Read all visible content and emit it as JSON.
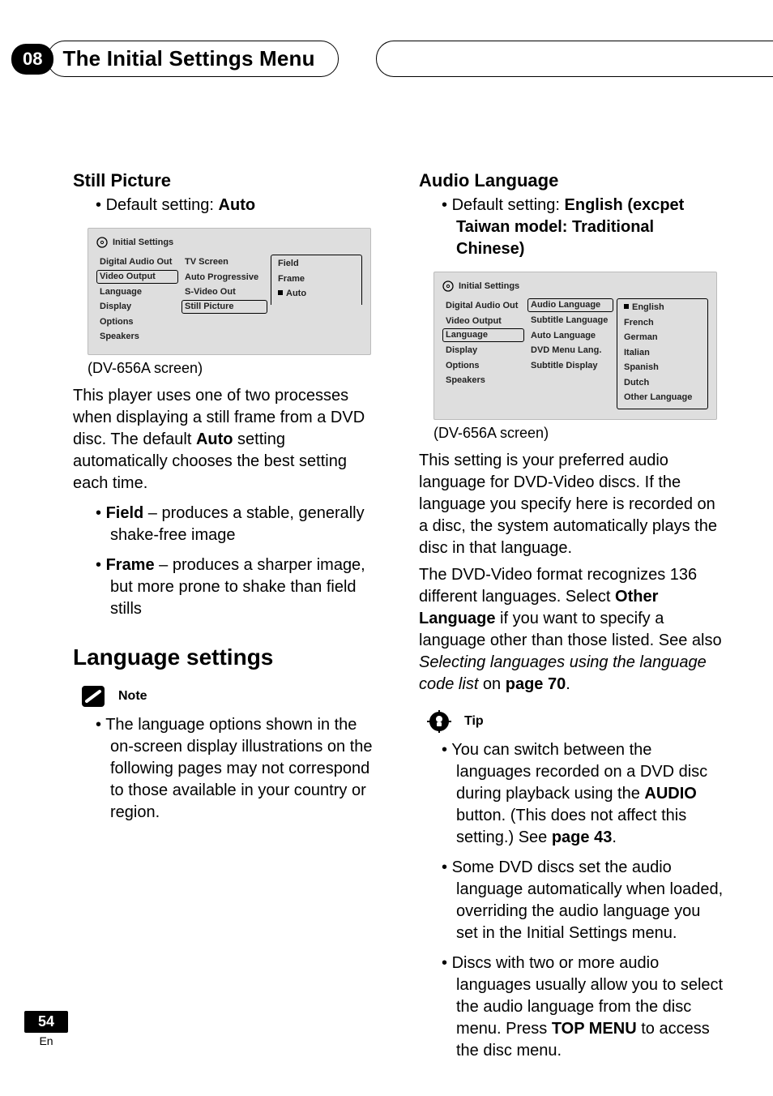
{
  "header": {
    "chapter": "08",
    "title": "The Initial Settings Menu"
  },
  "left": {
    "still_picture": {
      "heading": "Still Picture",
      "default_prefix": "Default setting: ",
      "default_value": "Auto",
      "menu": {
        "title": "Initial Settings",
        "col1": [
          "Digital Audio Out",
          "Video Output",
          "Language",
          "Display",
          "Options",
          "Speakers"
        ],
        "col1_selected": "Video Output",
        "col2": [
          "TV Screen",
          "Auto Progressive",
          "S-Video Out",
          "Still Picture"
        ],
        "col2_selected": "Still Picture",
        "col3": [
          "Field",
          "Frame",
          "Auto"
        ],
        "col3_marked": "Auto"
      },
      "caption": "(DV-656A screen)",
      "para1_a": "This player uses one of two processes when displaying a still frame from a DVD disc. The default ",
      "para1_bold": "Auto",
      "para1_b": " setting automatically chooses the best setting each time.",
      "bullets": [
        {
          "bold": "Field",
          "rest": " – produces a stable, generally shake-free image"
        },
        {
          "bold": "Frame",
          "rest": " – produces a sharper image, but more prone to shake than field stills"
        }
      ]
    },
    "lang_settings": {
      "heading": "Language settings",
      "note_label": "Note",
      "note_text": "The language options shown in the on-screen display illustrations on the following pages may not correspond to those available in your country or region."
    }
  },
  "right": {
    "audio_language": {
      "heading": "Audio Language",
      "default_prefix": "Default setting: ",
      "default_value": "English (excpet Taiwan model: Traditional Chinese)",
      "menu": {
        "title": "Initial Settings",
        "col1": [
          "Digital Audio Out",
          "Video Output",
          "Language",
          "Display",
          "Options",
          "Speakers"
        ],
        "col1_selected": "Language",
        "col2": [
          "Audio Language",
          "Subtitle Language",
          "Auto Language",
          "DVD Menu Lang.",
          "Subtitle Display"
        ],
        "col2_selected": "Audio Language",
        "col3": [
          "English",
          "French",
          "German",
          "Italian",
          "Spanish",
          "Dutch",
          "Other Language"
        ],
        "col3_marked": "English"
      },
      "caption": "(DV-656A screen)",
      "para1": "This setting is your preferred audio language for DVD-Video discs. If the language you specify here is recorded on a disc, the system automatically plays the disc in that language.",
      "para2_a": "The DVD-Video format recognizes 136 different languages. Select ",
      "para2_bold1": "Other Language",
      "para2_b": " if you want to specify a language other than those listed. See also ",
      "para2_ital": "Selecting languages using the language code list",
      "para2_c": " on ",
      "para2_bold2": "page 70",
      "para2_d": ".",
      "tip_label": "Tip",
      "tips": [
        {
          "a": "You can switch between the languages recorded on a DVD disc during playback using the ",
          "bold": "AUDIO",
          "b": " button. (This does not affect this setting.) See ",
          "bold2": "page 43",
          "c": "."
        },
        {
          "a": "Some DVD discs set the audio language automatically when loaded, overriding the audio language you set in the Initial Settings menu."
        },
        {
          "a": "Discs with two or more audio languages usually allow you to select the audio language from the disc menu. Press ",
          "bold": "TOP MENU",
          "b": " to access the disc menu."
        }
      ]
    }
  },
  "footer": {
    "page": "54",
    "lang": "En"
  }
}
